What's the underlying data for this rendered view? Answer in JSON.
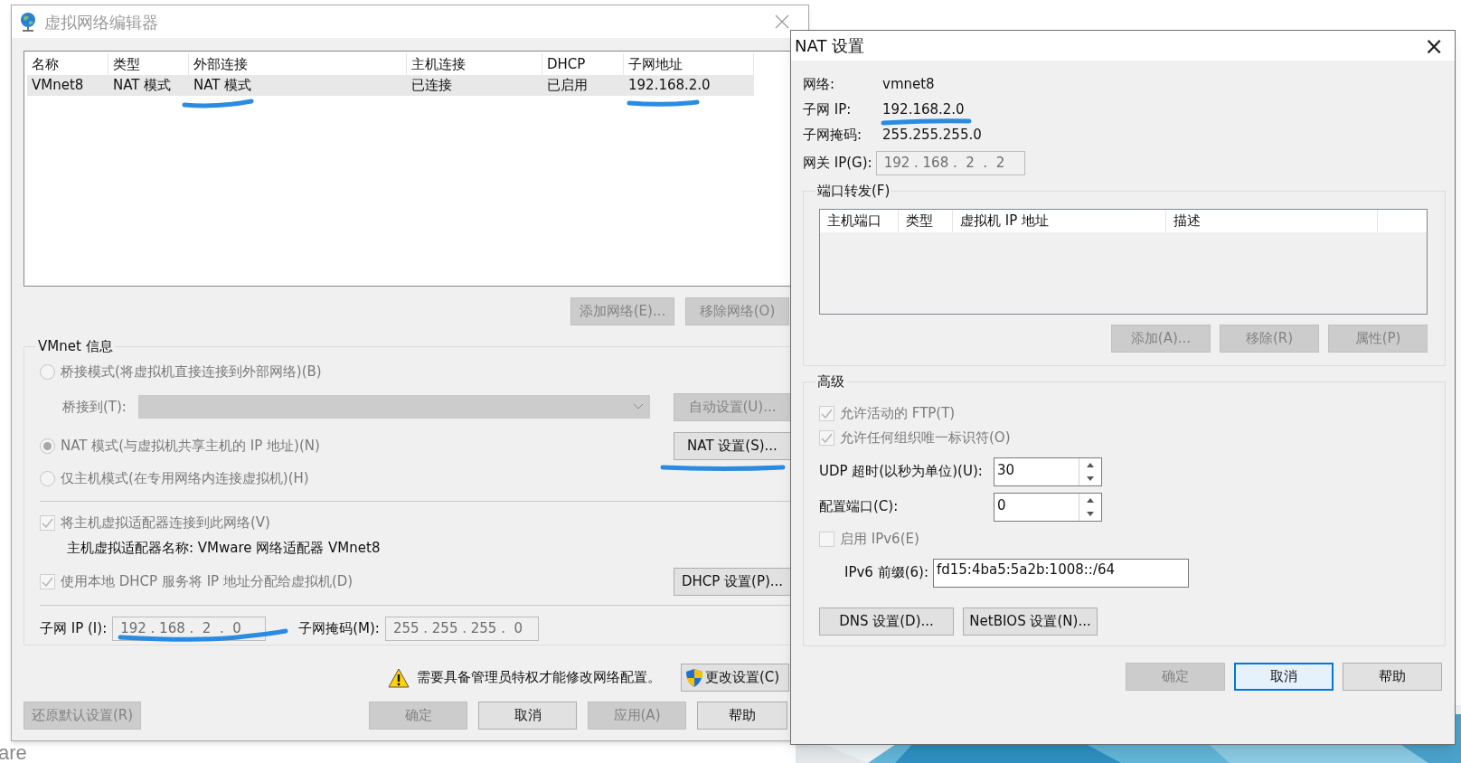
{
  "background_logo_text": "are",
  "editor_window": {
    "title": "虚拟网络编辑器",
    "table": {
      "columns": [
        "名称",
        "类型",
        "外部连接",
        "主机连接",
        "DHCP",
        "子网地址"
      ],
      "rows": [
        {
          "cells": [
            "VMnet8",
            "NAT 模式",
            "NAT 模式",
            "已连接",
            "已启用",
            "192.168.2.0"
          ],
          "selected": true
        }
      ]
    },
    "table_buttons": [
      {
        "label": "添加网络(E)...",
        "disabled": true
      },
      {
        "label": "移除网络(O)",
        "disabled": true
      }
    ],
    "vmnet_info": {
      "title": "VMnet 信息",
      "bridged_radio": {
        "label": "桥接模式(将虚拟机直接连接到外部网络)(B)",
        "selected": false,
        "disabled": true
      },
      "bridge_to": {
        "label": "桥接到(T):",
        "disabled": true
      },
      "auto_button": {
        "label": "自动设置(U)...",
        "disabled": true
      },
      "nat_radio": {
        "label": "NAT 模式(与虚拟机共享主机的 IP 地址)(N)",
        "selected": true,
        "disabled": true
      },
      "nat_button": {
        "label": "NAT 设置(S)...",
        "disabled": false
      },
      "hostonly_radio": {
        "label": "仅主机模式(在专用网络内连接虚拟机)(H)",
        "selected": false,
        "disabled": true
      },
      "connect_adapter": {
        "label": "将主机虚拟适配器连接到此网络(V)",
        "checked": true,
        "disabled": true
      },
      "adapter_name": "主机虚拟适配器名称: VMware 网络适配器 VMnet8",
      "use_dhcp": {
        "label": "使用本地 DHCP 服务将 IP 地址分配给虚拟机(D)",
        "checked": true,
        "disabled": true
      },
      "dhcp_button": {
        "label": "DHCP 设置(P)...",
        "disabled": false
      },
      "subnet_ip": {
        "label": "子网 IP (I):",
        "value": "192 . 168 .  2  .  0"
      },
      "subnet_mask": {
        "label": "子网掩码(M):",
        "value": "255 . 255 . 255 .  0"
      }
    },
    "warning": "需要具备管理员特权才能修改网络配置。",
    "change_button": "更改设置(C)",
    "buttons": [
      {
        "label": "还原默认设置(R)",
        "disabled": true
      },
      {
        "label": "确定",
        "disabled": true
      },
      {
        "label": "取消",
        "disabled": false
      },
      {
        "label": "应用(A)",
        "disabled": true
      },
      {
        "label": "帮助",
        "disabled": false
      }
    ]
  },
  "nat_dialog": {
    "title": "NAT 设置",
    "close": "×",
    "info": [
      {
        "label": "网络:",
        "value": "vmnet8"
      },
      {
        "label": "子网 IP:",
        "value": "192.168.2.0"
      },
      {
        "label": "子网掩码:",
        "value": "255.255.255.0"
      }
    ],
    "gateway": {
      "label": "网关 IP(G):",
      "value": "192 . 168 .  2  .  2"
    },
    "port_forwarding": {
      "title": "端口转发(F)",
      "columns": [
        "主机端口",
        "类型",
        "虚拟机 IP 地址",
        "描述"
      ],
      "buttons": [
        {
          "label": "添加(A)...",
          "disabled": true
        },
        {
          "label": "移除(R)",
          "disabled": true
        },
        {
          "label": "属性(P)",
          "disabled": true
        }
      ]
    },
    "advanced": {
      "title": "高级",
      "checkboxes": [
        {
          "label": "允许活动的 FTP(T)",
          "checked": true,
          "disabled": true
        },
        {
          "label": "允许任何组织唯一标识符(O)",
          "checked": true,
          "disabled": true
        }
      ],
      "spinners": [
        {
          "label": "UDP 超时(以秒为单位)(U):",
          "value": "30"
        },
        {
          "label": "配置端口(C):",
          "value": "0"
        }
      ],
      "ipv6": {
        "label": "启用 IPv6(E)",
        "checked": false,
        "disabled": true
      },
      "ipv6_prefix": {
        "label": "IPv6 前缀(6):",
        "value": "fd15:4ba5:5a2b:1008::/64"
      },
      "buttons": [
        {
          "label": "DNS 设置(D)..."
        },
        {
          "label": "NetBIOS 设置(N)..."
        }
      ]
    },
    "buttons": [
      {
        "label": "确定",
        "disabled": true,
        "focused": false
      },
      {
        "label": "取消",
        "disabled": false,
        "focused": true
      },
      {
        "label": "帮助",
        "disabled": false,
        "focused": false
      }
    ]
  }
}
